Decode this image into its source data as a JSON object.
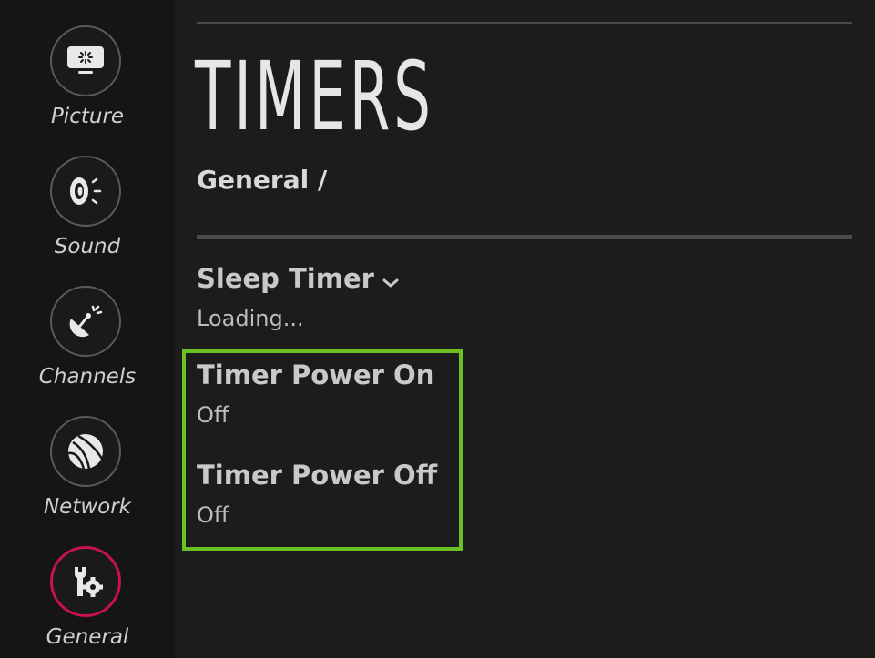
{
  "sidebar": {
    "items": [
      {
        "label": "Picture",
        "icon": "picture-icon",
        "active": false
      },
      {
        "label": "Sound",
        "icon": "sound-icon",
        "active": false
      },
      {
        "label": "Channels",
        "icon": "channels-icon",
        "active": false
      },
      {
        "label": "Network",
        "icon": "network-icon",
        "active": false
      },
      {
        "label": "General",
        "icon": "general-icon",
        "active": true
      }
    ]
  },
  "page": {
    "title": "TIMERS",
    "breadcrumb": "General /"
  },
  "menu": {
    "sleep_timer": {
      "title": "Sleep Timer",
      "value": "Loading...",
      "icon": "chevron-down-icon"
    },
    "timer_power_on": {
      "title": "Timer Power On",
      "value": "Off"
    },
    "timer_power_off": {
      "title": "Timer Power Off",
      "value": "Off"
    }
  },
  "colors": {
    "focus": "#6cc024",
    "active_nav": "#c8124f",
    "background": "#1c1c1c",
    "sidebar": "#151515"
  }
}
